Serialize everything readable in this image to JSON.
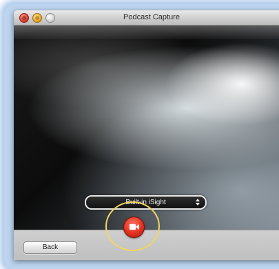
{
  "window": {
    "title": "Podcast Capture"
  },
  "camera_select": {
    "selected": "Built-in iSight",
    "icon": "updown-arrows-icon"
  },
  "toolbar": {
    "back_label": "Back",
    "record_icon": "video-camera-icon"
  },
  "colors": {
    "record_red": "#e23120",
    "highlight_yellow": "#f3d560",
    "glow_blue": "#bcd4ee"
  }
}
